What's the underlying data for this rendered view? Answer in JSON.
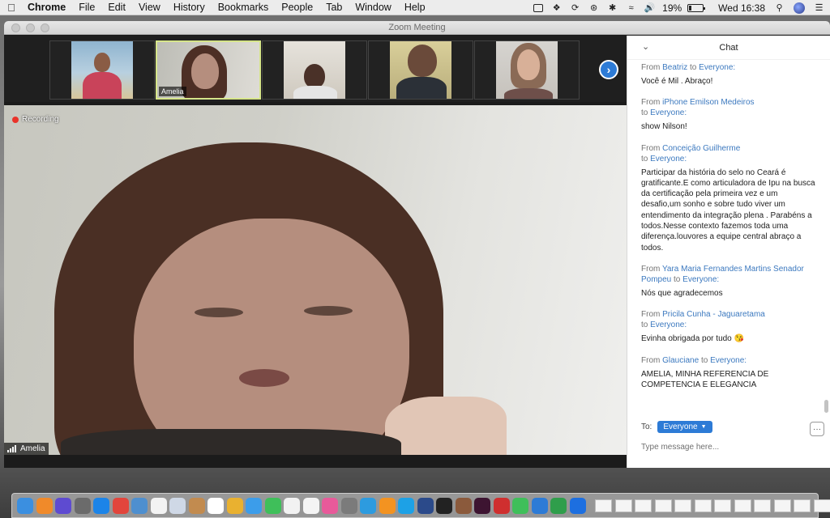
{
  "menubar": {
    "app": "Chrome",
    "items": [
      "File",
      "Edit",
      "View",
      "History",
      "Bookmarks",
      "People",
      "Tab",
      "Window",
      "Help"
    ],
    "battery": "19%",
    "battery_level": 0.19,
    "clock": "Wed 16:38"
  },
  "window": {
    "title": "Zoom Meeting"
  },
  "gallery": {
    "thumbs": [
      {
        "name": "",
        "active": false
      },
      {
        "name": "Amelia",
        "active": true
      },
      {
        "name": "",
        "active": false
      },
      {
        "name": "",
        "active": false
      },
      {
        "name": "",
        "active": false
      }
    ],
    "next_icon": "chevron-right-icon"
  },
  "main_video": {
    "recording_label": "Recording",
    "speaker_name": "Amelia"
  },
  "chat": {
    "title": "Chat",
    "from_word": "From",
    "to_word": "to",
    "messages": [
      {
        "sender": "Beatriz",
        "recipient": "Everyone:",
        "text": "Você é  Mil . Abraço!"
      },
      {
        "sender": "iPhone Emilson Medeiros",
        "recipient": "Everyone:",
        "text": "show Nilson!"
      },
      {
        "sender": "Conceição Guilherme",
        "recipient": "Everyone:",
        "text": "Participar da história do selo no Ceará é gratificante.E como articuladora de Ipu na busca da certificação pela primeira vez e um desafio,um sonho e sobre tudo viver um entendimento da integração plena . Parabéns a todos.Nesse contexto fazemos toda uma diferença.louvores a equipe central abraço a todos."
      },
      {
        "sender": "Yara Maria Fernandes Martins Senador Pompeu",
        "recipient": "Everyone:",
        "text": "Nós que agradecemos"
      },
      {
        "sender": "Pricila Cunha - Jaguaretama",
        "recipient": "Everyone:",
        "text": "Evinha obrigada por tudo 😘"
      },
      {
        "sender": "Glauciane",
        "recipient": "Everyone:",
        "text": "AMELIA, MINHA REFERENCIA DE COMPETENCIA E ELEGANCIA"
      }
    ],
    "to_label": "To:",
    "recipient_select": "Everyone",
    "more_label": "···",
    "input_placeholder": "Type message here..."
  },
  "dock": {
    "icons": [
      {
        "name": "finder-icon",
        "color": "#3b8fe0"
      },
      {
        "name": "launchpad-icon",
        "color": "#f08a2a"
      },
      {
        "name": "siri-icon",
        "color": "#5e4bd1"
      },
      {
        "name": "rocket-icon",
        "color": "#6b6b6b"
      },
      {
        "name": "safari-icon",
        "color": "#1c84e8"
      },
      {
        "name": "chrome-icon",
        "color": "#e2453c"
      },
      {
        "name": "preview-icon",
        "color": "#4e8fcf"
      },
      {
        "name": "notes-icon",
        "color": "#f3f3f3"
      },
      {
        "name": "photos-icon",
        "color": "#cfd8e6"
      },
      {
        "name": "clipboard-icon",
        "color": "#c28b4f"
      },
      {
        "name": "calendar-icon",
        "color": "#ffffff"
      },
      {
        "name": "photos2-icon",
        "color": "#e9b130"
      },
      {
        "name": "messages-icon",
        "color": "#3c9dea"
      },
      {
        "name": "facetime-icon",
        "color": "#3fbf5a"
      },
      {
        "name": "stickies-icon",
        "color": "#f2f2f2"
      },
      {
        "name": "textedit-icon",
        "color": "#f4f4f4"
      },
      {
        "name": "itunes-icon",
        "color": "#e85a9a"
      },
      {
        "name": "settings-icon",
        "color": "#7b7b7b"
      },
      {
        "name": "pen-icon",
        "color": "#2d9bdf"
      },
      {
        "name": "vlc-icon",
        "color": "#f39321"
      },
      {
        "name": "skype-icon",
        "color": "#1da1e6"
      },
      {
        "name": "bbedit-icon",
        "color": "#2b4a8a"
      },
      {
        "name": "geek-icon",
        "color": "#222222"
      },
      {
        "name": "books-icon",
        "color": "#8b5a3c"
      },
      {
        "name": "incopy-icon",
        "color": "#3d1431"
      },
      {
        "name": "app-store-icon",
        "color": "#cf2f2f"
      },
      {
        "name": "whatsapp-icon",
        "color": "#3fbf5a"
      },
      {
        "name": "zoom-icon",
        "color": "#2d7bd6"
      },
      {
        "name": "numbers-icon",
        "color": "#2f9e4b"
      },
      {
        "name": "dropbox-icon",
        "color": "#1d6fe0"
      }
    ],
    "windows_count": 12,
    "trash_icon": "trash-icon"
  }
}
